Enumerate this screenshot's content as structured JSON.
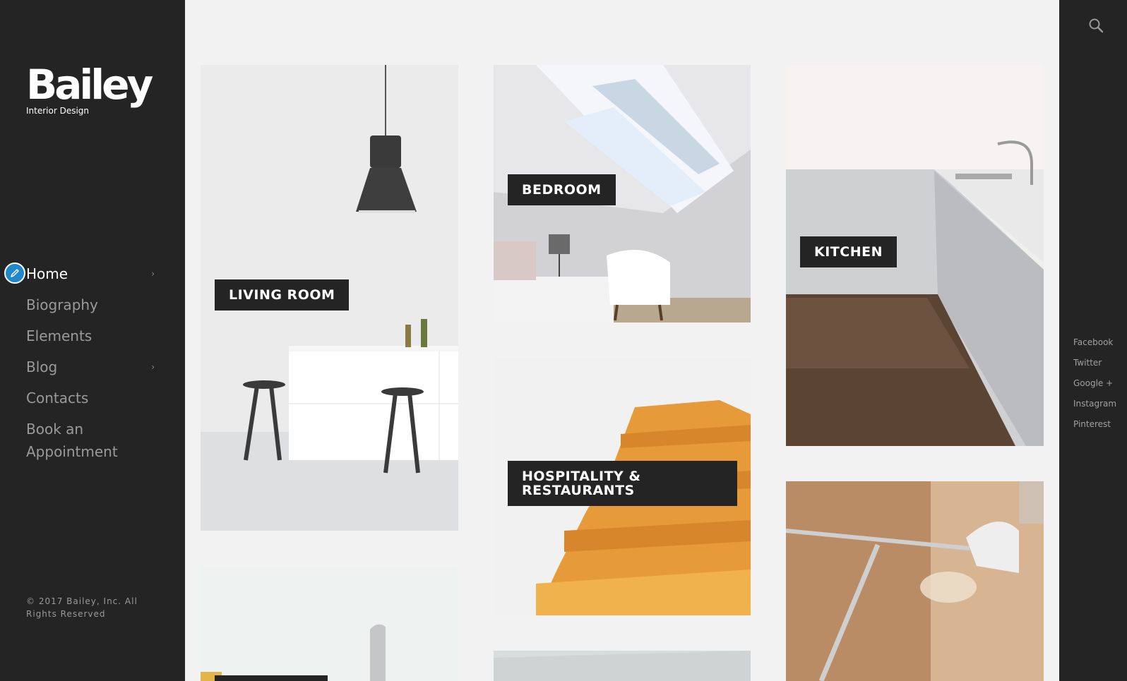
{
  "brand": {
    "name": "Bailey",
    "tagline": "Interior Design"
  },
  "nav": {
    "items": [
      {
        "label": "Home",
        "has_submenu": true,
        "active": true
      },
      {
        "label": "Biography",
        "has_submenu": false
      },
      {
        "label": "Elements",
        "has_submenu": false
      },
      {
        "label": "Blog",
        "has_submenu": true
      },
      {
        "label": "Contacts",
        "has_submenu": false
      },
      {
        "label": "Book an Appointment",
        "has_submenu": false
      }
    ],
    "chevron": "›"
  },
  "footer": {
    "copyright": "© 2017 Bailey, Inc. All Rights Reserved"
  },
  "social": {
    "links": [
      "Facebook",
      "Twitter",
      "Google +",
      "Instagram",
      "Pinterest"
    ]
  },
  "tiles": {
    "living_room": "LIVING ROOM",
    "bedroom": "BEDROOM",
    "kitchen": "KITCHEN",
    "hospitality_line1": "HOSPITALITY &",
    "hospitality_line2": "RESTAURANTS"
  },
  "colors": {
    "sidebar": "#242424",
    "background": "#f2f2f2",
    "accent": "#1e88c9",
    "label_bg": "#242424"
  }
}
